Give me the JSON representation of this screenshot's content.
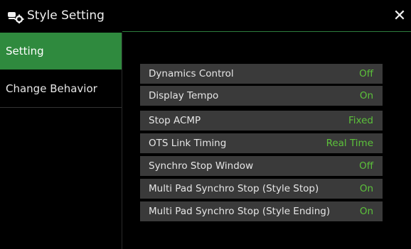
{
  "header": {
    "title": "Style Setting",
    "close_label": "✕",
    "icon": "style-setting-icon"
  },
  "sidebar": {
    "items": [
      {
        "label": "Setting",
        "active": true
      },
      {
        "label": "Change Behavior",
        "active": false
      }
    ]
  },
  "settings": [
    {
      "label": "Dynamics Control",
      "value": "Off"
    },
    {
      "label": "Display Tempo",
      "value": "On"
    },
    {
      "label": "Stop ACMP",
      "value": "Fixed"
    },
    {
      "label": "OTS Link Timing",
      "value": "Real Time"
    },
    {
      "label": "Synchro Stop Window",
      "value": "Off"
    },
    {
      "label": "Multi Pad Synchro Stop (Style Stop)",
      "value": "On"
    },
    {
      "label": "Multi Pad Synchro Stop (Style Ending)",
      "value": "On"
    }
  ],
  "colors": {
    "accent": "#2f8a3e",
    "value_text": "#5cc13a",
    "row_bg": "#3a3a3a"
  }
}
